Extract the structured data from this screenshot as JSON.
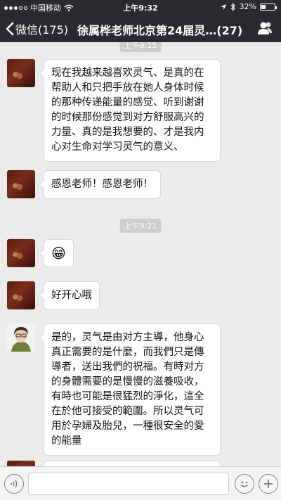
{
  "status_bar": {
    "carrier": "中国移动",
    "time": "上午9:32",
    "battery_percent": "32%",
    "battery_level": 0.32,
    "signal_dots": 5,
    "signal_filled": 3
  },
  "nav": {
    "back_label": "微信(175)",
    "title": "徐属桦老师北京第24届灵…(27)",
    "members_icon": "people-icon"
  },
  "chat": {
    "timestamps": [
      "上午9:15",
      "上午9:21"
    ],
    "messages": [
      {
        "avatar": "hands-avatar",
        "text": "现在我越来越喜欢灵气、是真的在帮助人和只把手放在她人身体时候的那种传递能量的感觉、听到谢谢的时候那份感觉到对方舒服高兴的力量、真的是我想要的、才是我内心对生命对学习灵气的意义、"
      },
      {
        "avatar": "hands-avatar",
        "text": "感恩老师！感恩老师！"
      },
      {
        "avatar": "hands-avatar",
        "emoji": "😁"
      },
      {
        "avatar": "hands-avatar",
        "text": "好开心哦"
      },
      {
        "avatar": "woman-avatar",
        "text": "是的，灵气是由对方主導，他身心真正需要的是什麼，而我們只是傳導者，送出我們的祝福。有時对方的身體需要的是慢慢的滋養吸收，有時也可能是很猛烈的淨化，這全在於他可接受的範圍。所以灵气可用於孕婦及胎兒，一種很安全的愛的能量"
      }
    ]
  },
  "input_bar": {
    "voice_icon": "voice-icon",
    "emoji_icon": "emoji-icon",
    "plus_icon": "plus-icon",
    "text_value": ""
  }
}
